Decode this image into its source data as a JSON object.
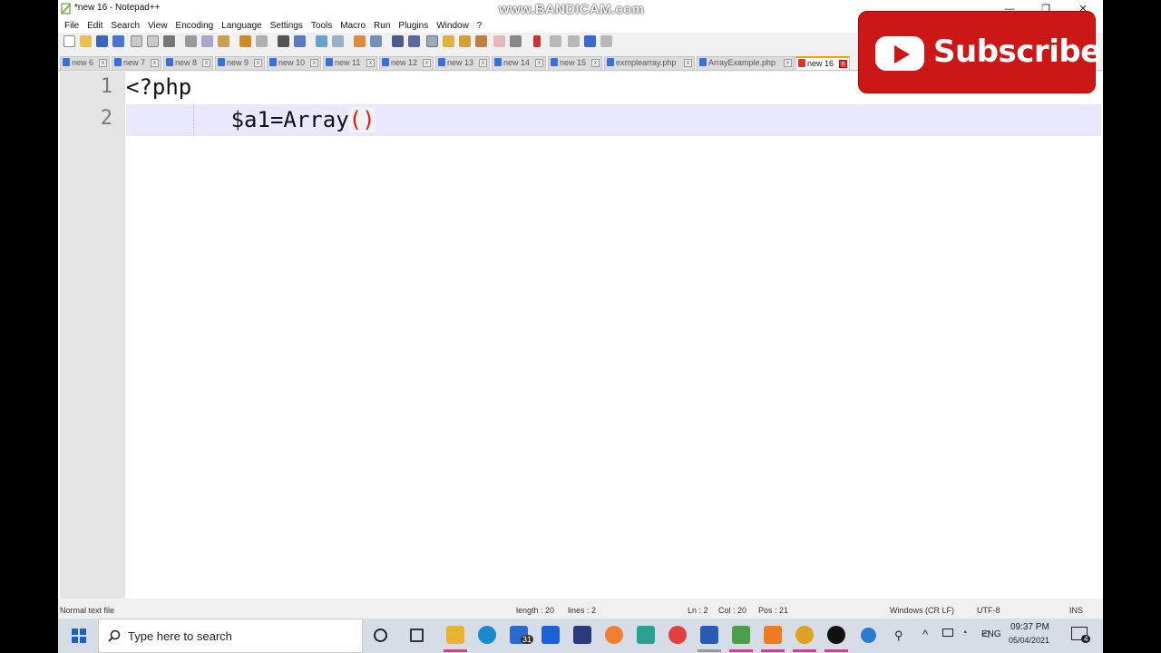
{
  "window": {
    "title": "*new 16 - Notepad++",
    "minimize": "—",
    "maximize": "❐",
    "close": "✕"
  },
  "menu": [
    "File",
    "Edit",
    "Search",
    "View",
    "Encoding",
    "Language",
    "Settings",
    "Tools",
    "Macro",
    "Run",
    "Plugins",
    "Window",
    "?"
  ],
  "tabs": [
    "new 6",
    "new 7",
    "new 8",
    "new 9",
    "new 10",
    "new 11",
    "new 12",
    "new 13",
    "new 14",
    "new 15",
    "exmplearray.php",
    "ArrayExample.php",
    "new 16"
  ],
  "tab_close": "x",
  "active_tab_index": 12,
  "editor": {
    "line_numbers": [
      "1",
      "2"
    ],
    "line1": "<?php",
    "line2_prefix": "        $a1=Array",
    "line2_paren_open": "(",
    "line2_paren_close": ")"
  },
  "status": {
    "file_type": "Normal text file",
    "length": "length : 20",
    "lines": "lines : 2",
    "ln": "Ln : 2",
    "col": "Col : 20",
    "pos": "Pos : 21",
    "eol": "Windows (CR LF)",
    "encoding": "UTF-8",
    "mode": "INS"
  },
  "watermark": "www.BANDICAM.com",
  "subscribe": {
    "label": "Subscribe"
  },
  "taskbar": {
    "search_placeholder": "Type here to search",
    "time": "09:37 PM",
    "date": "05/04/2021",
    "language": "ENG",
    "mail_badge": "31",
    "notification_count": "4"
  },
  "colors": {
    "accent_tab": "#f4a000",
    "paren": "#e01b1b",
    "current_line": "#e8e8ff",
    "subscribe_red": "#cc1717"
  }
}
